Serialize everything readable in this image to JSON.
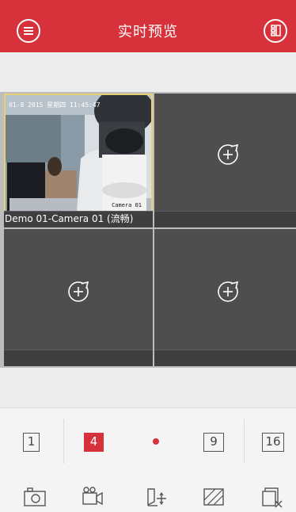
{
  "header": {
    "title": "实时预览",
    "menu_icon": "menu-icon",
    "layout_icon": "split-screen-icon",
    "bg_color": "#d7323b"
  },
  "preview": {
    "active_window": {
      "osd_time": "01-8 2015 星期四 11:45:47",
      "osd_camera": "Camera 01",
      "camera_label": "Demo 01-Camera 01 (流畅)"
    },
    "empty_window_icon": "add-channel-icon"
  },
  "split_options": {
    "items": [
      "1",
      "4",
      "9",
      "16"
    ],
    "selected": "4",
    "page_indicator": "red-dot"
  },
  "toolbar": {
    "icons": [
      "capture-icon",
      "record-icon",
      "ptz-icon",
      "image-quality-icon",
      "close-all-icon"
    ]
  }
}
